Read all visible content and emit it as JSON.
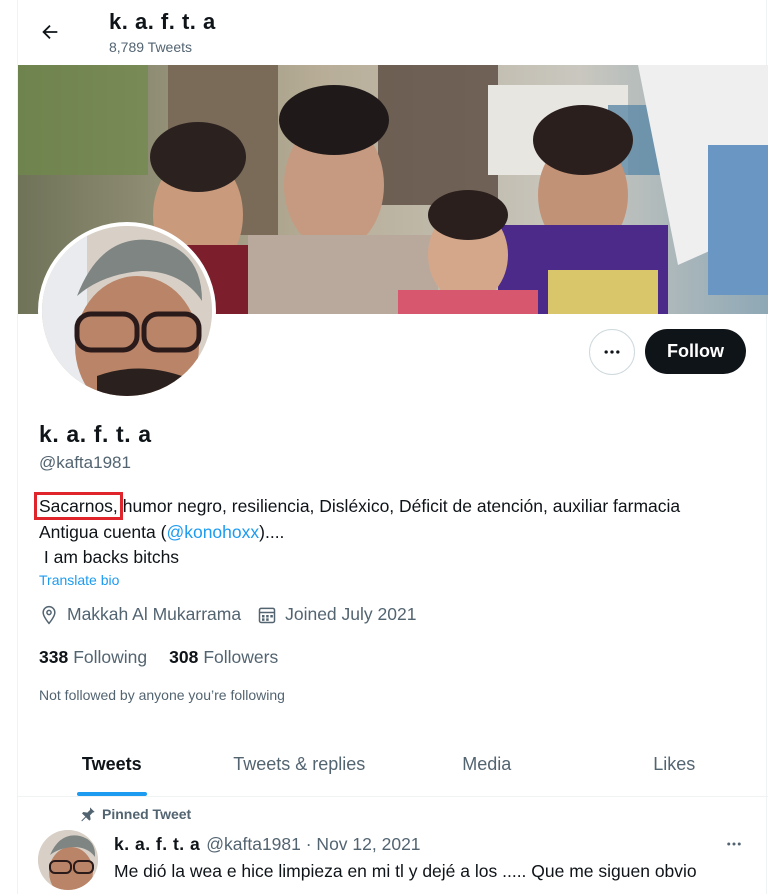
{
  "header": {
    "name": "k. a. f. t. a",
    "tweet_count": "8,789 Tweets"
  },
  "profile": {
    "name": "k. a. f. t. a",
    "handle": "@kafta1981",
    "follow_label": "Follow",
    "bio": {
      "highlighted_word": "Sacarnos,",
      "line1_rest": "humor negro, resiliencia, Disléxico, Déficit de atención, auxiliar farmacia",
      "line2_prefix": "Antigua cuenta (",
      "line2_mention": "@konohoxx",
      "line2_suffix": ")....",
      "line3": " I am backs bitchs"
    },
    "translate_label": "Translate bio",
    "location": "Makkah Al Mukarrama",
    "joined": "Joined July 2021",
    "following_count": "338",
    "following_label": "Following",
    "followers_count": "308",
    "followers_label": "Followers",
    "not_followed": "Not followed by anyone you’re following"
  },
  "tabs": [
    {
      "label": "Tweets",
      "active": true
    },
    {
      "label": "Tweets & replies",
      "active": false
    },
    {
      "label": "Media",
      "active": false
    },
    {
      "label": "Likes",
      "active": false
    }
  ],
  "pinned_tweet": {
    "pinned_label": "Pinned Tweet",
    "name": "k. a. f. t. a",
    "meta": "@kafta1981 · Nov 12, 2021",
    "text": "Me dió la wea e hice limpieza en mi tl y dejé a los ..... Que me siguen obvio"
  },
  "colors": {
    "accent": "#1d9bf0",
    "highlight_box": "#e0242b",
    "follow_bg": "#0f1419",
    "secondary_text": "#536471"
  },
  "icons": {
    "back": "arrow-left-icon",
    "more": "more-horizontal-icon",
    "location": "location-pin-icon",
    "calendar": "calendar-icon",
    "pin": "pin-icon"
  }
}
